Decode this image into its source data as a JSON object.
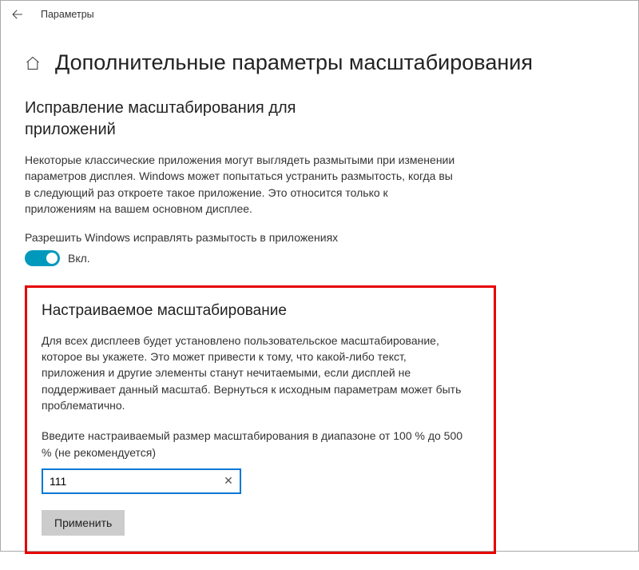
{
  "titlebar": {
    "label": "Параметры"
  },
  "page": {
    "title": "Дополнительные параметры масштабирования"
  },
  "fix_section": {
    "title": "Исправление масштабирования для приложений",
    "description": "Некоторые классические приложения могут выглядеть размытыми при изменении параметров дисплея. Windows может попытаться устранить размытость, когда вы в следующий раз откроете такое приложение. Это относится только к приложениям на вашем основном дисплее.",
    "toggle_label": "Разрешить Windows исправлять размытость в приложениях",
    "toggle_state": "Вкл."
  },
  "custom_section": {
    "title": "Настраиваемое масштабирование",
    "description": "Для всех дисплеев будет установлено пользовательское масштабирование, которое вы укажете. Это может привести к тому, что какой-либо текст, приложения и другие элементы станут нечитаемыми, если дисплей не поддерживает данный масштаб. Вернуться к исходным параметрам может быть проблематично.",
    "input_label": "Введите настраиваемый размер масштабирования в диапазоне от 100 % до 500 % (не рекомендуется)",
    "input_value": "111",
    "clear_glyph": "✕",
    "apply_label": "Применить"
  }
}
